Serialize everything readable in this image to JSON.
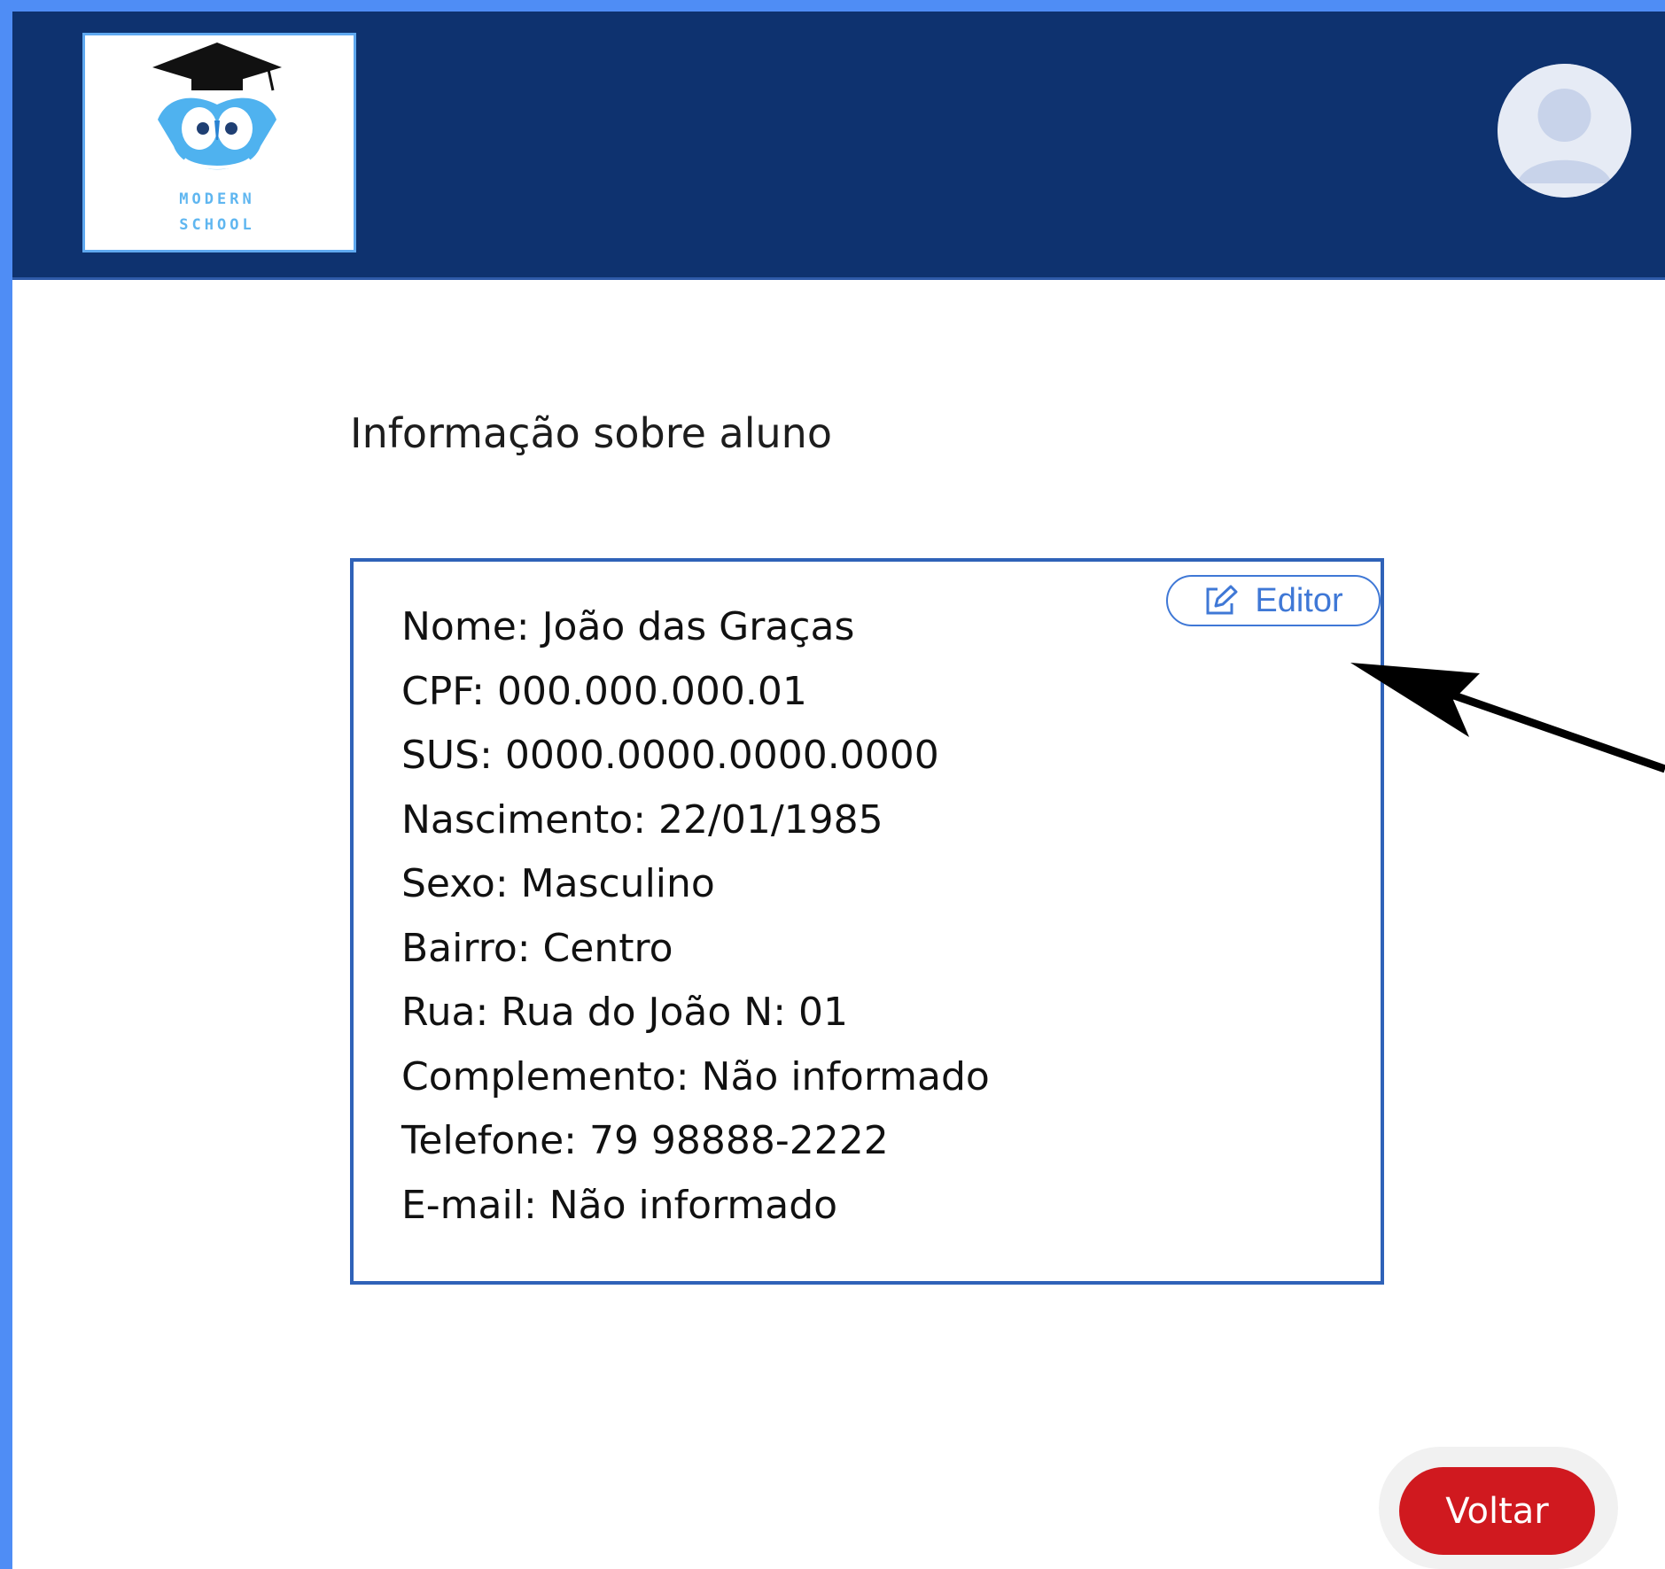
{
  "header": {
    "logo": {
      "line1": "MODERN",
      "line2": "SCHOOL"
    },
    "avatar_icon": "user-avatar-icon"
  },
  "page": {
    "title": "Informação sobre aluno"
  },
  "card": {
    "edit_label": "Editor",
    "edit_icon": "pencil-square-icon",
    "fields": [
      "Nome: João das Graças",
      "CPF: 000.000.000.01",
      "SUS: 0000.0000.0000.0000",
      "Nascimento: 22/01/1985",
      "Sexo: Masculino",
      "Bairro: Centro",
      "Rua: Rua do João N: 01",
      "Complemento: Não informado",
      "Telefone: 79 98888-2222",
      "E-mail: Não informado"
    ]
  },
  "footer": {
    "back_label": "Voltar"
  },
  "colors": {
    "frame": "#4f8df5",
    "header": "#0e326f",
    "card_border": "#2f62b8",
    "accent": "#3f78d6",
    "back_button": "#d0191f"
  }
}
